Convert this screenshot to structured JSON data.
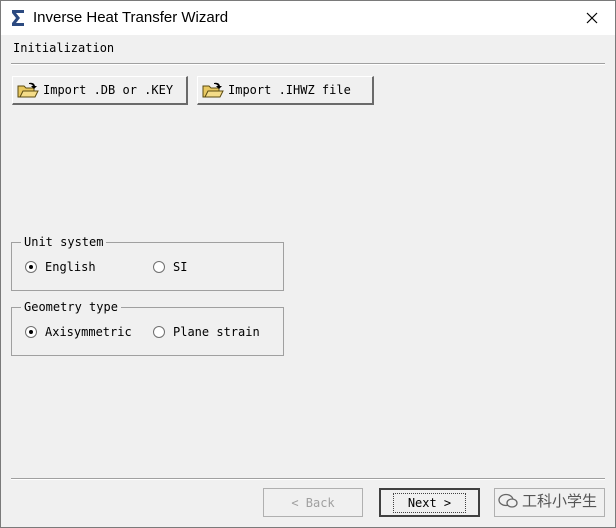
{
  "window": {
    "title": "Inverse Heat Transfer Wizard"
  },
  "section": {
    "title": "Initialization"
  },
  "toolbar": {
    "import_db_label": "Import .DB or .KEY",
    "import_ihwz_label": "Import .IHWZ file"
  },
  "unit_system": {
    "legend": "Unit system",
    "options": [
      {
        "label": "English",
        "selected": true
      },
      {
        "label": "SI",
        "selected": false
      }
    ]
  },
  "geometry_type": {
    "legend": "Geometry type",
    "options": [
      {
        "label": "Axisymmetric",
        "selected": true
      },
      {
        "label": "Plane strain",
        "selected": false
      }
    ]
  },
  "nav": {
    "back_label": "< Back",
    "next_label": "Next >"
  },
  "watermark": {
    "text": "工科小学生"
  }
}
